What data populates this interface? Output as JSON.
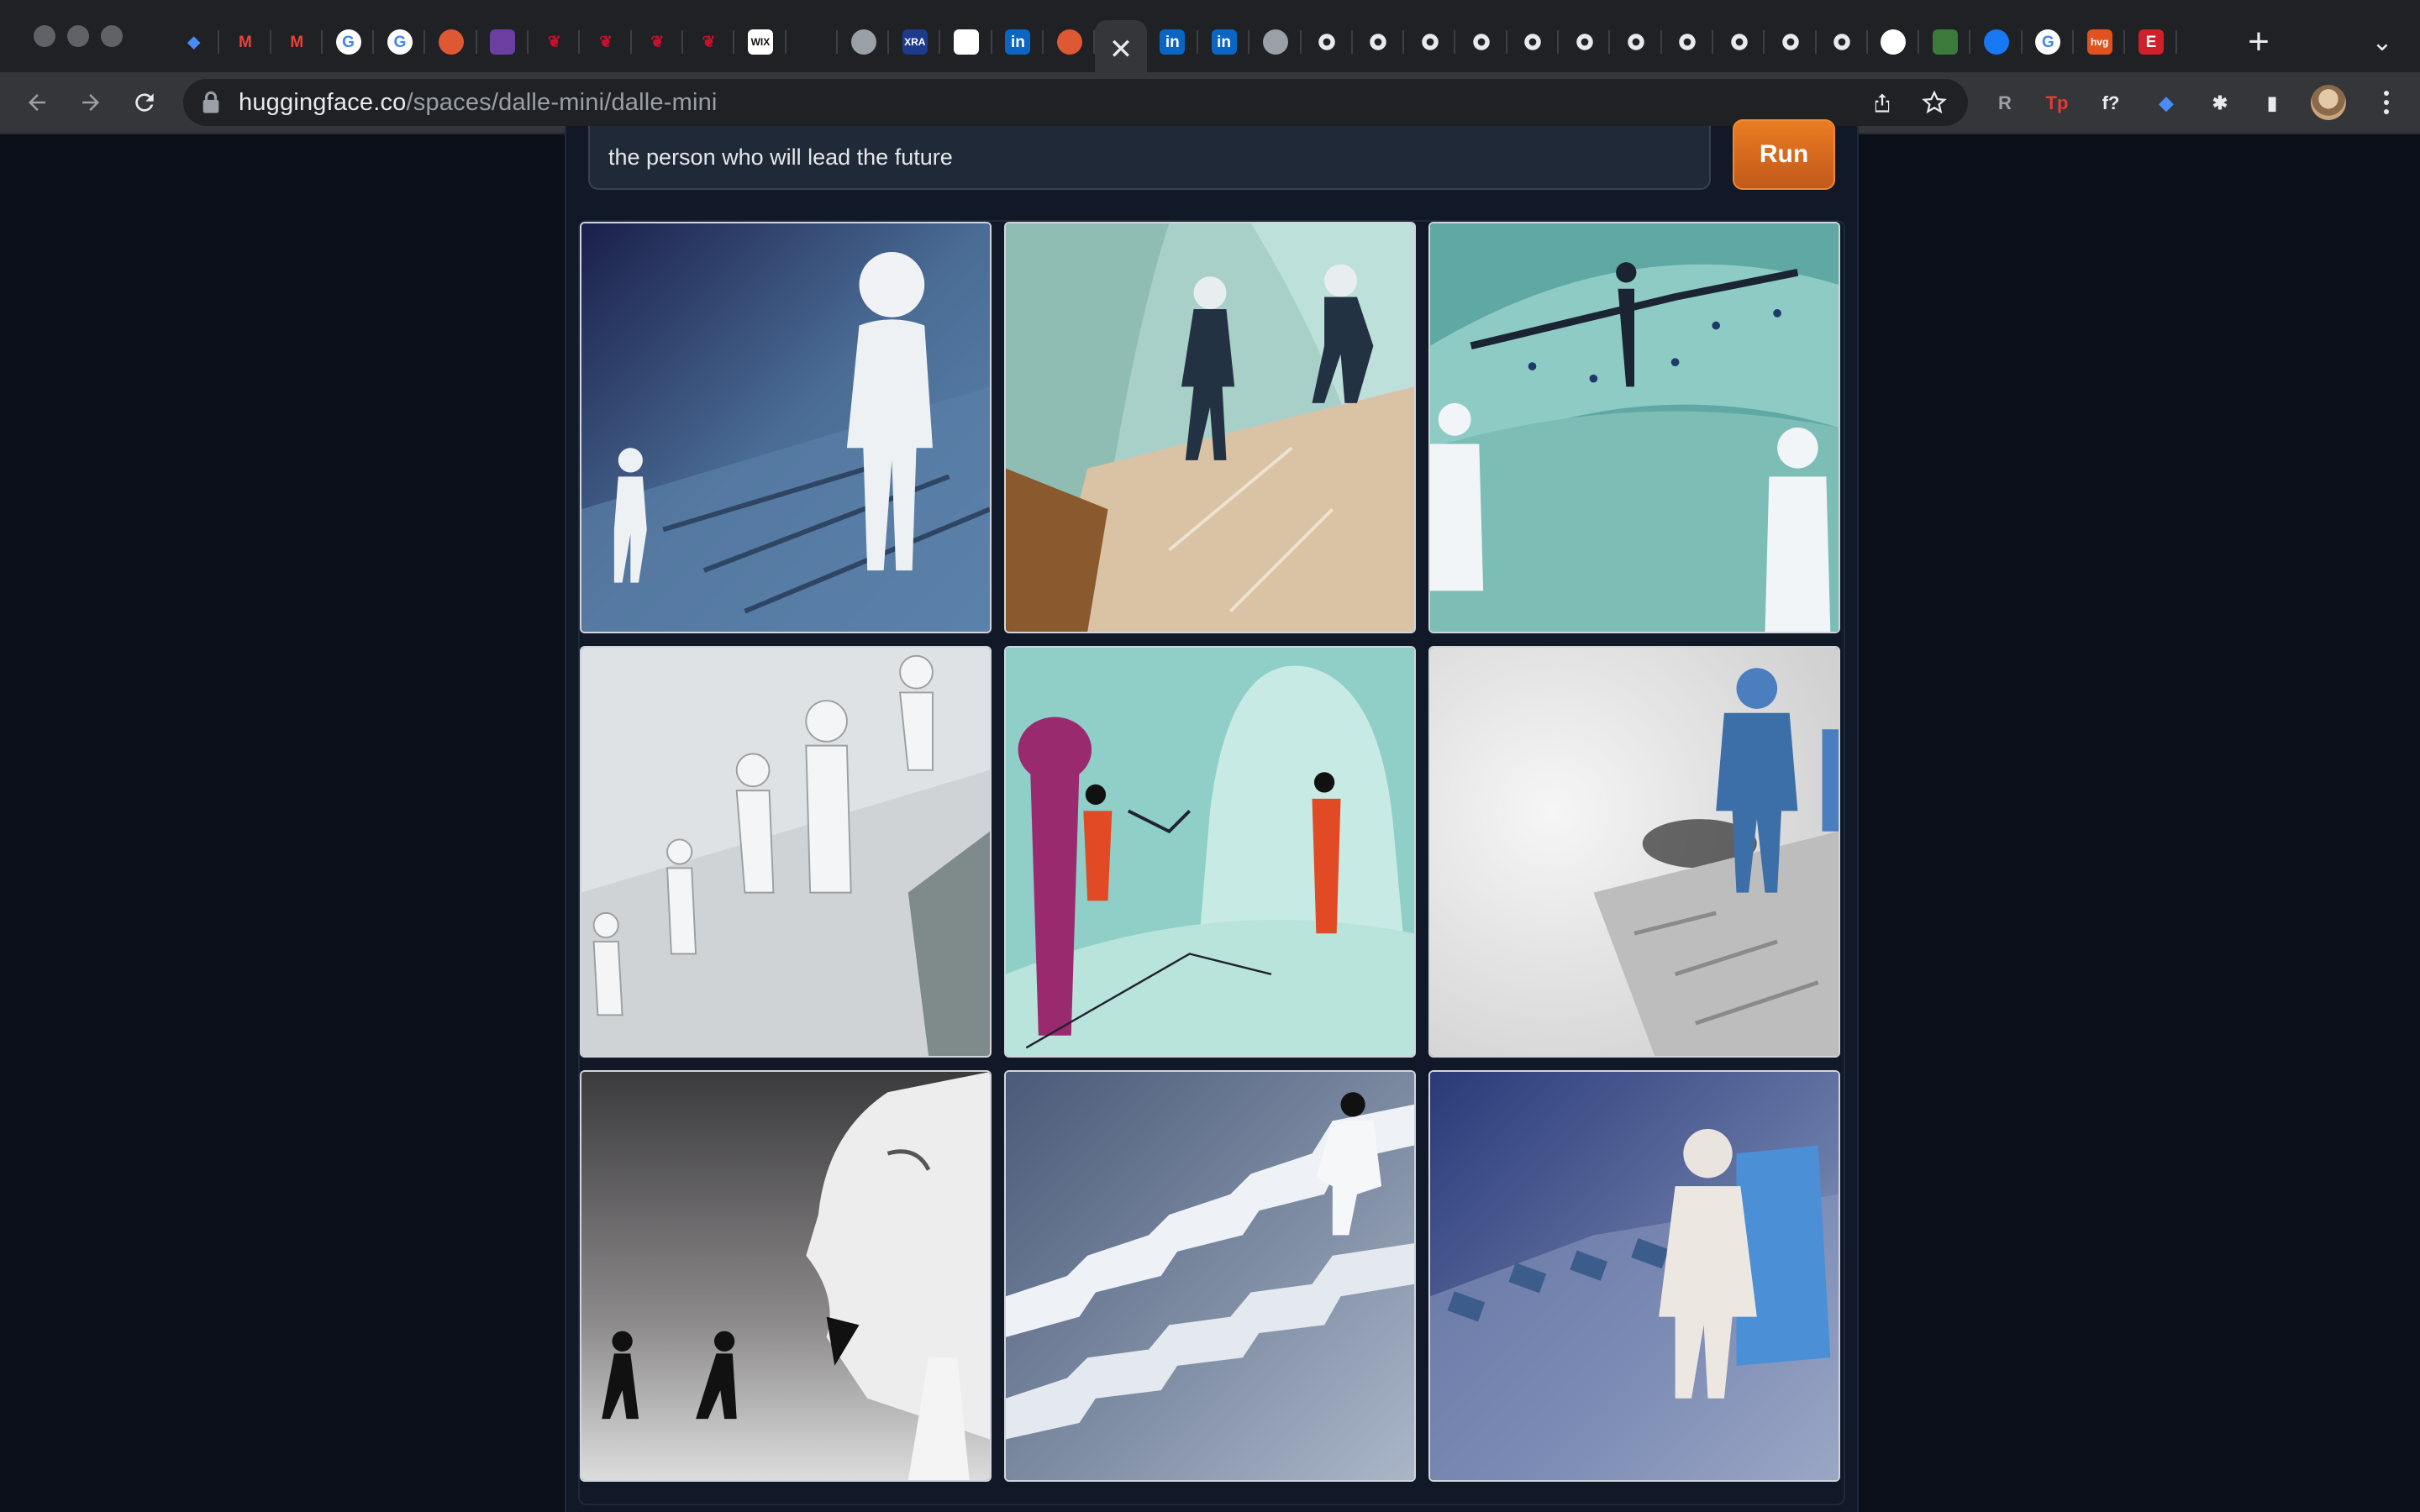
{
  "browser": {
    "tabs": [
      {
        "icon": "gem-icon",
        "color": "#4a8cf7"
      },
      {
        "icon": "gmail-icon",
        "color": "#ea4335"
      },
      {
        "icon": "gmail-icon",
        "color": "#ea4335"
      },
      {
        "icon": "google-icon",
        "color": "#4285f4"
      },
      {
        "icon": "google-icon",
        "color": "#4285f4"
      },
      {
        "icon": "duckduckgo-icon",
        "color": "#de5833"
      },
      {
        "icon": "purple-app-icon",
        "color": "#6b3fa0"
      },
      {
        "icon": "red-pin-icon",
        "color": "#c8102e"
      },
      {
        "icon": "red-pin-icon",
        "color": "#c8102e"
      },
      {
        "icon": "red-pin-icon",
        "color": "#c8102e"
      },
      {
        "icon": "red-pin-icon",
        "color": "#c8102e"
      },
      {
        "icon": "wix-icon",
        "color": "#ffffff",
        "label": "WIX"
      },
      {
        "icon": "blank-icon",
        "color": "#202124"
      },
      {
        "icon": "globe-icon",
        "color": "#9aa0a6"
      },
      {
        "icon": "xra-icon",
        "color": "#1e3a8a",
        "label": "XRA"
      },
      {
        "icon": "white-square-icon",
        "color": "#ffffff"
      },
      {
        "icon": "linkedin-icon",
        "color": "#0a66c2",
        "label": "in"
      },
      {
        "icon": "duckduckgo-icon",
        "color": "#de5833"
      },
      {
        "icon": "close-icon",
        "color": "#e8eaed",
        "active": true
      },
      {
        "icon": "linkedin-icon",
        "color": "#0a66c2",
        "label": "in"
      },
      {
        "icon": "linkedin-icon",
        "color": "#0a66c2",
        "label": "in"
      },
      {
        "icon": "globe-icon",
        "color": "#9aa0a6"
      },
      {
        "icon": "settings-gear-icon",
        "color": "#e8eaed"
      },
      {
        "icon": "settings-gear-icon",
        "color": "#e8eaed"
      },
      {
        "icon": "settings-gear-icon",
        "color": "#e8eaed"
      },
      {
        "icon": "settings-gear-icon",
        "color": "#e8eaed"
      },
      {
        "icon": "settings-gear-icon",
        "color": "#e8eaed"
      },
      {
        "icon": "settings-gear-icon",
        "color": "#e8eaed"
      },
      {
        "icon": "settings-gear-icon",
        "color": "#e8eaed"
      },
      {
        "icon": "settings-gear-icon",
        "color": "#e8eaed"
      },
      {
        "icon": "settings-gear-icon",
        "color": "#e8eaed"
      },
      {
        "icon": "settings-gear-icon",
        "color": "#e8eaed"
      },
      {
        "icon": "settings-gear-icon",
        "color": "#e8eaed"
      },
      {
        "icon": "github-icon",
        "color": "#ffffff"
      },
      {
        "icon": "green-badge-icon",
        "color": "#3b7a3b"
      },
      {
        "icon": "facebook-icon",
        "color": "#1877f2"
      },
      {
        "icon": "google-icon",
        "color": "#4285f4"
      },
      {
        "icon": "hvg-icon",
        "color": "#e0531f",
        "label": "hvg"
      },
      {
        "icon": "e-icon",
        "color": "#d0202a",
        "label": "E"
      }
    ],
    "new_tab_glyph": "+",
    "tab_search_glyph": "⌄",
    "url_host": "huggingface.co",
    "url_path": "/spaces/dalle-mini/dalle-mini",
    "extensions": [
      {
        "icon": "extension-r-icon",
        "color": "#9aa0a6",
        "label": "R"
      },
      {
        "icon": "extension-tp-icon",
        "color": "#e53935",
        "label": "Tp"
      },
      {
        "icon": "extension-fx-icon",
        "color": "#e8eaed",
        "label": "f?"
      },
      {
        "icon": "extension-gem-icon",
        "color": "#4a8cf7",
        "label": "◆"
      },
      {
        "icon": "puzzle-icon",
        "color": "#e8eaed",
        "label": "✱"
      },
      {
        "icon": "side-panel-icon",
        "color": "#e8eaed",
        "label": "▮"
      }
    ]
  },
  "app": {
    "prompt_value": "the person who will lead the future",
    "run_label": "Run",
    "images": [
      {
        "name": "generated-image-1",
        "scene": "blue-figures"
      },
      {
        "name": "generated-image-2",
        "scene": "beige-arch"
      },
      {
        "name": "generated-image-3",
        "scene": "teal-room"
      },
      {
        "name": "generated-image-4",
        "scene": "white-walkers"
      },
      {
        "name": "generated-image-5",
        "scene": "teal-red-figures"
      },
      {
        "name": "generated-image-6",
        "scene": "blue-person-stairs"
      },
      {
        "name": "generated-image-7",
        "scene": "face-walkers"
      },
      {
        "name": "generated-image-8",
        "scene": "white-stairs"
      },
      {
        "name": "generated-image-9",
        "scene": "blue-hug"
      }
    ]
  }
}
